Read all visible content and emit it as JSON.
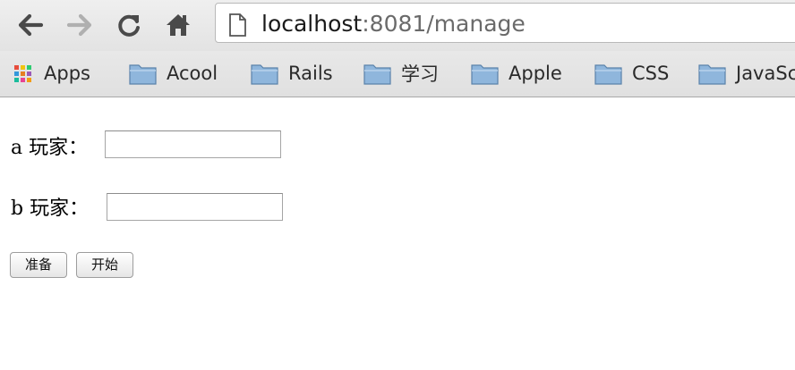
{
  "browser": {
    "url_host": "localhost",
    "url_path": ":8081/manage",
    "bookmarks": [
      {
        "label": "Apps",
        "icon": "apps-grid-icon"
      },
      {
        "label": "Acool",
        "icon": "folder-icon"
      },
      {
        "label": "Rails",
        "icon": "folder-icon"
      },
      {
        "label": "学习",
        "icon": "folder-icon"
      },
      {
        "label": "Apple",
        "icon": "folder-icon"
      },
      {
        "label": "CSS",
        "icon": "folder-icon"
      },
      {
        "label": "JavaSc",
        "icon": "folder-icon"
      }
    ]
  },
  "form": {
    "player_a_label": "a 玩家：",
    "player_a_value": "",
    "player_b_label": "b 玩家：",
    "player_b_value": "",
    "ready_button": "准备",
    "start_button": "开始"
  },
  "colors": {
    "folder_blue": "#7aa6cf",
    "apps_grid": [
      "#e74c3c",
      "#f1c40f",
      "#2ecc71",
      "#3498db",
      "#e67e22",
      "#9b59b6",
      "#1abc9c",
      "#e84393",
      "#f39c12"
    ]
  }
}
